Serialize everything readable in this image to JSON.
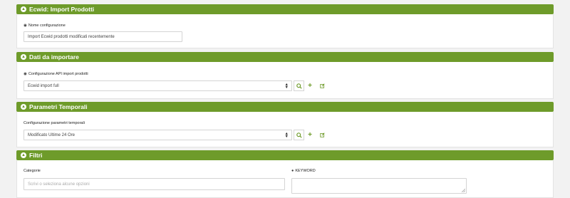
{
  "sections": {
    "import": {
      "title": "Ecwid: Import Prodotti",
      "name_label": "Nome configurazione",
      "name_value": "Import Ecwid prodotti modificati recentemente"
    },
    "data": {
      "title": "Dati da importare",
      "api_label": "Configurazione API import prodotti",
      "api_value": "Ecwid import full"
    },
    "time": {
      "title": "Parametri Temporali",
      "time_label": "Configurazione parametri temporali",
      "time_value": "Modificato Ultime 24 Ore"
    },
    "filters": {
      "title": "Filtri",
      "categories_label": "Categorie",
      "categories_placeholder": "Scrivi o seleziona alcune opzioni",
      "keyword_label": "KEYWORD"
    }
  },
  "colors": {
    "accent": "#6e9b2a"
  },
  "icons": [
    "chevron-up-icon",
    "eye-icon",
    "search-icon",
    "plus-icon",
    "edit-icon",
    "help-icon",
    "select-arrows-icon",
    "resize-handle-icon"
  ]
}
